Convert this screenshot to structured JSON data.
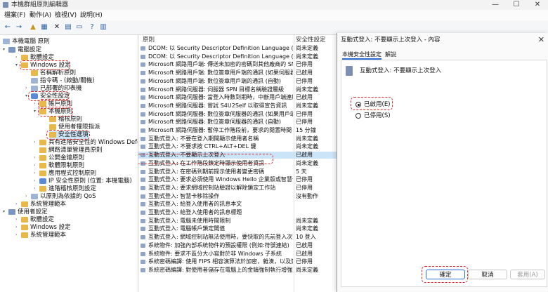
{
  "window": {
    "title": "本機群組原則編輯器",
    "controls": {
      "minimize": "—",
      "maximize": "☐",
      "close": "✕"
    }
  },
  "menu": [
    {
      "label": "檔案(F)"
    },
    {
      "label": "動作(A)"
    },
    {
      "label": "檢視(V)"
    },
    {
      "label": "說明(H)"
    }
  ],
  "toolbar": {
    "buttons": [
      {
        "name": "back-icon",
        "glyph": "←"
      },
      {
        "name": "forward-icon",
        "glyph": "→"
      },
      {
        "name": "up-folder-icon",
        "glyph": "▲"
      },
      {
        "name": "show-tree-icon",
        "glyph": "▦"
      },
      {
        "name": "delete-icon",
        "glyph": "✕"
      },
      {
        "name": "properties-icon",
        "glyph": "▤"
      },
      {
        "name": "export-icon",
        "glyph": "▭"
      },
      {
        "name": "help-icon",
        "glyph": "?"
      },
      {
        "name": "show-pane-icon",
        "glyph": "▥"
      }
    ]
  },
  "tree": {
    "items": [
      {
        "label": "本機電腦 原則",
        "indent": 0,
        "icon": "doc",
        "twisty": ""
      },
      {
        "label": "電腦設定",
        "indent": 1,
        "icon": "pc",
        "twisty": "▾"
      },
      {
        "label": "軟體設定",
        "indent": 2,
        "icon": "folder",
        "twisty": "›"
      },
      {
        "label": "Windows 設定",
        "indent": 2,
        "icon": "folder",
        "twisty": "▾"
      },
      {
        "label": "名稱解析原則",
        "indent": 3,
        "icon": "folder",
        "twisty": ""
      },
      {
        "label": "指令碼 - (啟動/關機)",
        "indent": 3,
        "icon": "doc",
        "twisty": ""
      },
      {
        "label": "已部署的印表機",
        "indent": 3,
        "icon": "doc",
        "twisty": "›"
      },
      {
        "label": "安全性設定",
        "indent": 3,
        "icon": "shield",
        "twisty": "▾"
      },
      {
        "label": "帳戶原則",
        "indent": 4,
        "icon": "folder",
        "twisty": "›"
      },
      {
        "label": "本機原則",
        "indent": 4,
        "icon": "folder",
        "twisty": "▾"
      },
      {
        "label": "稽核原則",
        "indent": 5,
        "icon": "folder",
        "twisty": ""
      },
      {
        "label": "使用者權限指派",
        "indent": 5,
        "icon": "folder",
        "twisty": ""
      },
      {
        "label": "安全性選項",
        "indent": 5,
        "icon": "folder",
        "twisty": ""
      },
      {
        "label": "具有進階安全性的 Windows Defender",
        "indent": 4,
        "icon": "folder",
        "twisty": "›"
      },
      {
        "label": "網路清單管理員原則",
        "indent": 4,
        "icon": "folder",
        "twisty": ""
      },
      {
        "label": "公開金鑰原則",
        "indent": 4,
        "icon": "folder",
        "twisty": "›"
      },
      {
        "label": "軟體限制原則",
        "indent": 4,
        "icon": "folder",
        "twisty": "›"
      },
      {
        "label": "應用程式控制原則",
        "indent": 4,
        "icon": "folder",
        "twisty": "›"
      },
      {
        "label": "IP 安全性原則 (位置: 本機電腦)",
        "indent": 4,
        "icon": "shield",
        "twisty": "›"
      },
      {
        "label": "進階稽核原則設定",
        "indent": 4,
        "icon": "folder",
        "twisty": "›"
      },
      {
        "label": "以原則為依據的 QoS",
        "indent": 3,
        "icon": "doc",
        "twisty": "›"
      },
      {
        "label": "系統管理範本",
        "indent": 2,
        "icon": "folder",
        "twisty": "›"
      },
      {
        "label": "使用者設定",
        "indent": 1,
        "icon": "pc",
        "twisty": "▾"
      },
      {
        "label": "軟體設定",
        "indent": 2,
        "icon": "folder",
        "twisty": "›"
      },
      {
        "label": "Windows 設定",
        "indent": 2,
        "icon": "folder",
        "twisty": "›"
      },
      {
        "label": "系統管理範本",
        "indent": 2,
        "icon": "folder",
        "twisty": "›"
      }
    ]
  },
  "list": {
    "columns": {
      "policy": "原則",
      "setting": "安全性設定"
    },
    "rows": [
      {
        "name": "DCOM: 以 Security Descriptor Definition Language (SDD...",
        "value": "尚未定義"
      },
      {
        "name": "DCOM: 以 Security Descriptor Definition Language (SDD...",
        "value": "尚未定義"
      },
      {
        "name": "Microsoft 網路用戶端: 傳送未加密的密碼到其他廠商的 SM...",
        "value": "已停用"
      },
      {
        "name": "Microsoft 網路用戶端: 數位簽章用戶端的通訊 (如果伺服器...",
        "value": "已啟用"
      },
      {
        "name": "Microsoft 網路用戶端: 數位簽章用戶端的通訊 (自動)",
        "value": "已停用"
      },
      {
        "name": "Microsoft 網路伺服器: 伺服器 SPN 目標名稱驗證層級",
        "value": "尚未定義"
      },
      {
        "name": "Microsoft 網路伺服器: 當登入時數到期時，中斷用戶端連線",
        "value": "已啟用"
      },
      {
        "name": "Microsoft 網路伺服器: 嘗試 S4U2Self 以取得宣告資訊",
        "value": "尚未定義"
      },
      {
        "name": "Microsoft 網路伺服器: 數位簽章伺服器的通訊 (如果用戶端...",
        "value": "已停用"
      },
      {
        "name": "Microsoft 網路伺服器: 數位簽章伺服器的通訊 (自動)",
        "value": "已停用"
      },
      {
        "name": "Microsoft 網路伺服器: 暫停工作階段前，要求的閒置時間",
        "value": "15 分鐘"
      },
      {
        "name": "互動式登入: 不要在登入期間顯示使用者名稱",
        "value": "尚未定義"
      },
      {
        "name": "互動式登入: 不要求按 CTRL+ALT+DEL 鍵",
        "value": "尚未定義"
      },
      {
        "name": "互動式登入: 不要顯示上次登入",
        "value": "已啟用",
        "selected": true
      },
      {
        "name": "互動式登入: 在工作階段鎖定時顯示使用者資訊",
        "value": "尚未定義"
      },
      {
        "name": "互動式登入: 在密碼到期前提示使用者變更密碼",
        "value": "5 天"
      },
      {
        "name": "互動式登入: 要求必須使用 Windows Hello 企業版或智慧卡",
        "value": "已停用"
      },
      {
        "name": "互動式登入: 要求網域控制站驗證以解除鎖定工作站",
        "value": "已停用"
      },
      {
        "name": "互動式登入: 智慧卡移除操作",
        "value": "沒有動作"
      },
      {
        "name": "互動式登入: 給登入使用者的訊息本文",
        "value": ""
      },
      {
        "name": "互動式登入: 給登入使用者的訊息標題",
        "value": ""
      },
      {
        "name": "互動式登入: 電腦未使用時間限制",
        "value": "尚未定義"
      },
      {
        "name": "互動式登入: 電腦帳戶鎖定閾值",
        "value": "尚未定義"
      },
      {
        "name": "互動式登入: 網域控制站無法使用時，要快取的先前登入次數",
        "value": "10 登入"
      },
      {
        "name": "系統物件: 加強內部系統物件的預設權限 (例如:符號連結)",
        "value": "已啟用"
      },
      {
        "name": "系統物件: 要求不區分大小寫對於非 Windows 子系統",
        "value": "已啟用"
      },
      {
        "name": "系統密碼編譯: 使用 FIPS 相容演算法於加密，雜湊，以及簽章",
        "value": "已停用"
      },
      {
        "name": "系統密碼編譯: 對使用者儲存在電腦上的金鑰強制執行增強式...",
        "value": "尚未定義"
      }
    ]
  },
  "dialog": {
    "title": "互動式登入: 不要顯示上次登入 - 內容",
    "close": "✕",
    "tabs": [
      {
        "label": "本機安全性設定"
      },
      {
        "label": "解說"
      }
    ],
    "policy_name": "互動式登入: 不要顯示上次登入",
    "options": [
      {
        "label": "已啟用(E)",
        "checked": true
      },
      {
        "label": "已停用(S)",
        "checked": false
      }
    ],
    "buttons": {
      "ok": "確定",
      "cancel": "取消",
      "apply": "套用(A)"
    }
  }
}
